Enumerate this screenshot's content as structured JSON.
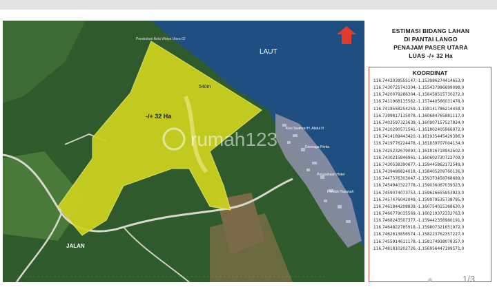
{
  "map": {
    "water_label": "LAUT",
    "area_label": "-/+ 32 Ha",
    "distance_label": "540m",
    "road_label": "JALAN",
    "watermark": "rumah123",
    "place_labels": [
      "Perabuhan Bela Widya Utara 02",
      "Kios Seafood H. Abdul H",
      "Dermaga Penta",
      "Perusahaan Hotel",
      "Pondok Hasanah"
    ],
    "colors": {
      "sea": "#1f4f80",
      "forest": "#2f5a2c",
      "parcel_fill": "#cfd41e",
      "north_arrow": "#e23b2e"
    },
    "icons": [
      "north-arrow-icon"
    ]
  },
  "info": {
    "title_lines": [
      "ESTIMASI BIDANG LAHAN",
      "DI PANTAI LANGO",
      "PENAJAM PASER UTARA",
      "LUAS -/+ 32 Ha"
    ],
    "koordinat_title": "KOORDINAT",
    "coordinates": [
      "116.74420395551​47,-1.1539862744146​53,0",
      "116.7430725743304,-1.155437996699098,0",
      "116.7420079286304,-1.156458515730272,0",
      "116.7411968135562,-1.157440566031478,0",
      "116.7418558254259,-1.158141786214458,0",
      "116.7399817115078,-1.160684765881117,0",
      "116.7403597323639,-1.160907157527834,0",
      "116.7410290571541,-1.161802405966072,0",
      "116.7414189443420,-1.161935445429386,0",
      "116.7419776224478,-1.161839707004134,0",
      "116.7425232679093,-1.161816718942502,0",
      "116.7430215846961,-1.160602730722709,0",
      "116.7430538390677,-1.159445862172549,0",
      "116.7439486824018,-1.158405209760136,0",
      "116.7447576303047,-1.159373458768689,0",
      "116.7454940322778,-1.159036067039323,0",
      "116.7459074073753,-1.159626655953923,0",
      "116.7457476042049,-1.159979535738795,0",
      "116.7461844208839,-1.160754015368630,0",
      "116.7466779035569,-1.160219372332763,0",
      "116.7468243507377,-1.159442356980191,0",
      "116.7464822785918,-1.159807321651972,0",
      "116.7462613856574,-1.158223762357227,0",
      "116.7455914611178,-1.158174938078357,0",
      "116.7481810202726,-1.156956447199571,0"
    ]
  },
  "pager": {
    "label": "1/3"
  }
}
